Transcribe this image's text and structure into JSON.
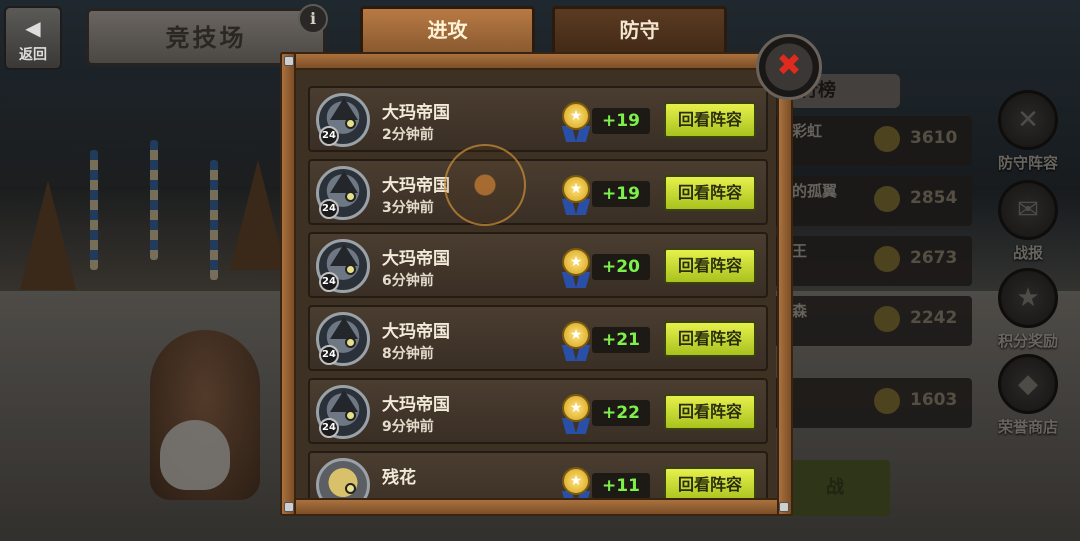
{
  "header": {
    "back_label": "返回",
    "title": "竞技场",
    "info_glyph": "i"
  },
  "tabs": [
    {
      "label": "进攻",
      "active": true
    },
    {
      "label": "防守",
      "active": false
    }
  ],
  "close_glyph": "✖",
  "battle_log": [
    {
      "name": "大玛帝国",
      "time": "2分钟前",
      "level": "24",
      "score": "+19",
      "button": "回看阵容"
    },
    {
      "name": "大玛帝国",
      "time": "3分钟前",
      "level": "24",
      "score": "+19",
      "button": "回看阵容"
    },
    {
      "name": "大玛帝国",
      "time": "6分钟前",
      "level": "24",
      "score": "+20",
      "button": "回看阵容"
    },
    {
      "name": "大玛帝国",
      "time": "8分钟前",
      "level": "24",
      "score": "+21",
      "button": "回看阵容"
    },
    {
      "name": "大玛帝国",
      "time": "9分钟前",
      "level": "24",
      "score": "+22",
      "button": "回看阵容"
    },
    {
      "name": "残花",
      "time": "",
      "level": "",
      "score": "+11",
      "button": "回看阵容"
    }
  ],
  "background_ranking": {
    "tab_label": "行榜",
    "rows": [
      {
        "name": "彩虹",
        "points": "3610"
      },
      {
        "name": "的孤翼",
        "points": "2854"
      },
      {
        "name": "王",
        "points": "2673"
      },
      {
        "name": "森",
        "points": "2242"
      },
      {
        "name": "",
        "points": "1603"
      }
    ],
    "battle_button": "战"
  },
  "sidebar": [
    {
      "label": "防守阵容",
      "icon": "shield-icon"
    },
    {
      "label": "战报",
      "icon": "scroll-icon"
    },
    {
      "label": "积分奖励",
      "icon": "medal-icon"
    },
    {
      "label": "荣誉商店",
      "icon": "shop-icon"
    }
  ],
  "colors": {
    "score_green": "#7ef04a",
    "replay_button": "#d4e23a",
    "active_tab": "#b87a44",
    "close_x": "#e02a1e"
  }
}
